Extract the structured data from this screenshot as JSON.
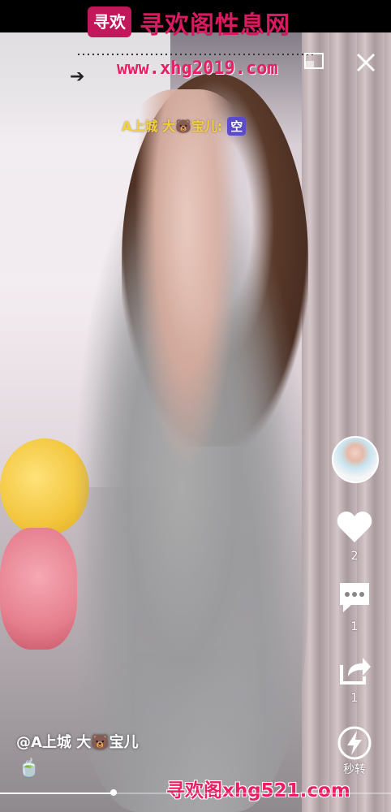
{
  "watermark": {
    "logo_text": "寻欢",
    "site_title": "寻欢阁性息网",
    "url": "www.xhg2019.com",
    "arrow": "➔",
    "bottom_text": "寻欢阁xhg521.com"
  },
  "danmaku": {
    "text": "A上城 大",
    "emoji": "🐻",
    "suffix": "宝儿:",
    "badge": "空"
  },
  "actions": {
    "like_count": "2",
    "comment_count": "1",
    "share_count": "1",
    "rotate_label": "秒转"
  },
  "post": {
    "author_prefix": "@A上城 大",
    "author_emoji": "🐻",
    "author_suffix": "宝儿",
    "music_icon": "🍵"
  },
  "progress": {
    "played_fraction": 0.29
  },
  "icons": {
    "close": "close-icon",
    "pip": "picture-in-picture-icon",
    "like": "heart-icon",
    "comment": "comment-icon",
    "share": "share-icon",
    "rotate": "lightning-icon"
  },
  "colors": {
    "watermark": "#e91e63",
    "danmaku": "#f4d23b",
    "badge": "#5b4ccf"
  }
}
